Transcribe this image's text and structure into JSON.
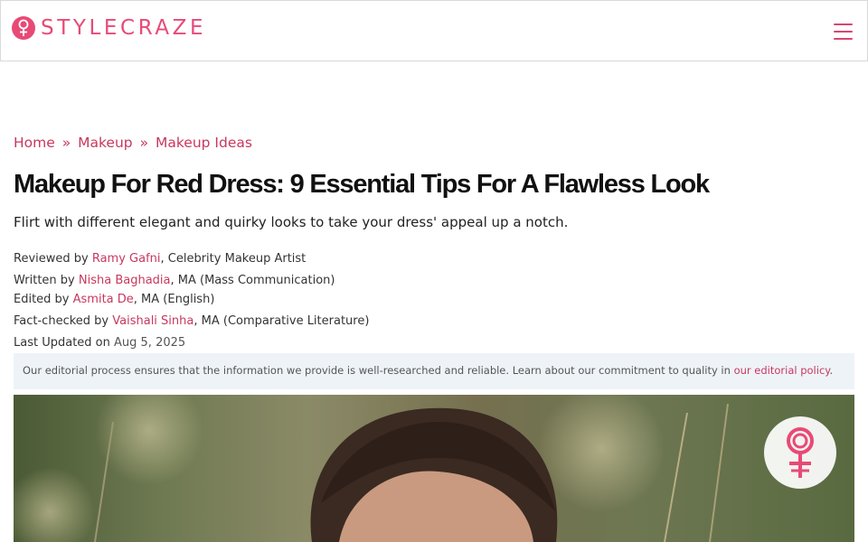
{
  "header": {
    "logo_text": "STYLECRAZE",
    "menu_icon": "hamburger-menu-icon",
    "brand_color": "#e84a76"
  },
  "breadcrumb": {
    "items": [
      "Home",
      "Makeup",
      "Makeup Ideas"
    ],
    "separator": "»"
  },
  "article": {
    "title": "Makeup For Red Dress: 9 Essential Tips For A Flawless Look",
    "subtitle": "Flirt with different elegant and quirky looks to take your dress' appeal up a notch."
  },
  "credits": {
    "reviewed": {
      "prefix": "Reviewed by ",
      "name": "Ramy Gafni",
      "suffix": ", Celebrity Makeup Artist"
    },
    "written": {
      "prefix": "Written by ",
      "name": "Nisha Baghadia",
      "suffix": ", MA (Mass Communication)"
    },
    "edited": {
      "prefix": "Edited by ",
      "name": "Asmita De",
      "suffix": ", MA (English)"
    },
    "fact_checked": {
      "prefix": "Fact-checked by ",
      "name": "Vaishali Sinha",
      "suffix": ", MA (Comparative Literature)"
    },
    "updated": {
      "prefix": "Last Updated on ",
      "date": "Aug 5, 2025"
    }
  },
  "editorial": {
    "text": "Our editorial process ensures that the information we provide is well-researched and reliable. Learn about our commitment to quality in ",
    "link": "our editorial policy",
    "end": "."
  },
  "hero": {
    "badge_icon": "stylecraze-badge-icon"
  }
}
